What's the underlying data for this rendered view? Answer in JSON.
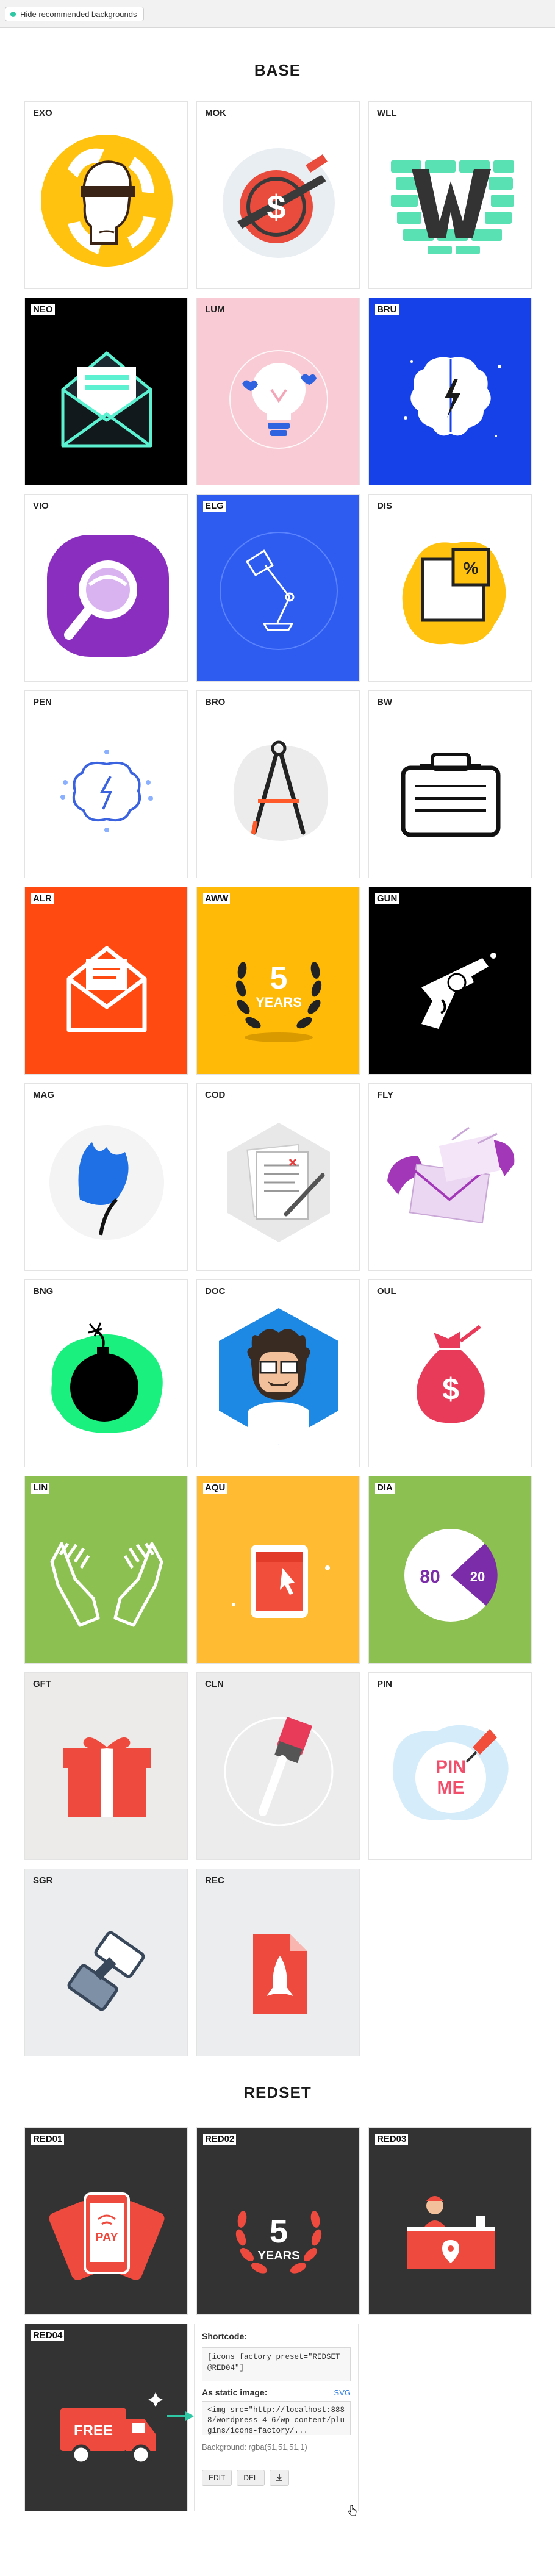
{
  "toolbar": {
    "toggle_label": "Hide recommended backgrounds"
  },
  "sections": {
    "base": "BASE",
    "redset": "REDSET"
  },
  "cards": {
    "exo": "EXO",
    "mok": "MOK",
    "wll": "WLL",
    "neo": "NEO",
    "lum": "LUM",
    "bru": "BRU",
    "vio": "VIO",
    "elg": "ELG",
    "dis": "DIS",
    "pen": "PEN",
    "bro": "BRO",
    "bw": "BW",
    "alr": "ALR",
    "aww": "AWW",
    "gun": "GUN",
    "mag": "MAG",
    "cod": "COD",
    "fly": "FLY",
    "bng": "BNG",
    "doc": "DOC",
    "oul": "OUL",
    "lin": "LIN",
    "aqu": "AQU",
    "dia": "DIA",
    "gft": "GFT",
    "cln": "CLN",
    "pin": "PIN",
    "sgr": "SGR",
    "rec": "REC",
    "red01": "RED01",
    "red02": "RED02",
    "red03": "RED03",
    "red04": "RED04"
  },
  "icon_text": {
    "aww_number": "5",
    "aww_word": "YEARS",
    "dia_left": "80",
    "dia_right": "20",
    "pin_line1": "PIN",
    "pin_line2": "ME",
    "red01_pay": "PAY",
    "red02_number": "5",
    "red02_word": "YEARS",
    "red04_free": "FREE"
  },
  "panel": {
    "shortcode_heading": "Shortcode:",
    "shortcode_value": "[icons_factory preset=\"REDSET @RED04\"]",
    "static_heading": "As static image:",
    "svg_link": "SVG",
    "img_value": "<img src=\"http://localhost:8888/wordpress-4-6/wp-content/plugins/icons-factory/...",
    "background_text": "Background: rgba(51,51,51,1)",
    "edit_button": "EDIT",
    "del_button": "DEL",
    "download_icon": "download-icon"
  },
  "colors": {
    "neo": "#000000",
    "bru": "#1640e8",
    "elg": "#2f5cf0",
    "alr": "#ff4b12",
    "aww": "#ffba08",
    "gun": "#000000",
    "lin": "#8cc152",
    "aqu": "#ffbb32",
    "dia": "#8cc152",
    "redset_bg": "#333333",
    "accent": "#2ec9a4"
  }
}
